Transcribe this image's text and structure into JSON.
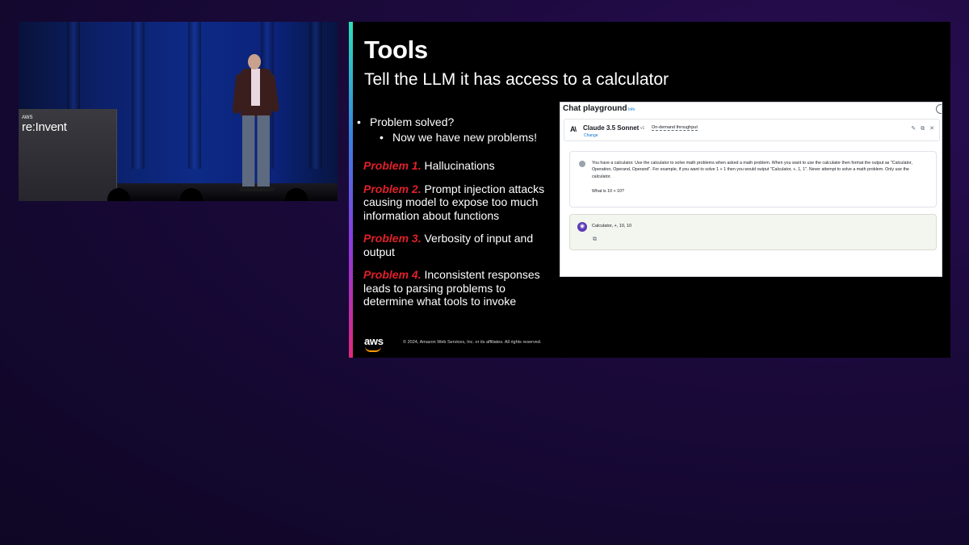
{
  "video": {
    "podium_logo_small": "AWS",
    "podium_logo": "re:Invent"
  },
  "slide": {
    "title": "Tools",
    "subtitle": "Tell the LLM it has access to a calculator",
    "bullets": [
      {
        "text": "Problem solved?",
        "sub": "Now we have new problems!"
      }
    ],
    "problems": [
      {
        "tag": "Problem 1.",
        "text": "Hallucinations"
      },
      {
        "tag": "Problem 2.",
        "text": "Prompt injection attacks causing model to expose too much information about functions"
      },
      {
        "tag": "Problem 3.",
        "text": "Verbosity of input and output"
      },
      {
        "tag": "Problem 4.",
        "text": "Inconsistent responses leads to parsing problems to determine what tools to invoke"
      }
    ],
    "footer_logo": "aws",
    "copyright": "© 2024, Amazon Web Services, Inc. or its affiliates. All rights reserved."
  },
  "playground": {
    "title": "Chat playground",
    "info": "Info",
    "model_icon": "A\\",
    "model_name": "Claude 3.5 Sonnet",
    "model_version": "v1",
    "throughput": "On-demand throughput",
    "change": "Change",
    "icons": [
      "broom-icon",
      "copy-icon",
      "close-icon"
    ],
    "user_prompt": "You have a calculator. Use the calculator to solve math problems when asked a math problem. When you want to use the calculator then format the output as \"Calculator, Operation, Operand, Operand\". For example, if you want to solve 1 + 1 then you would output \"Calculator, +, 1, 1\". Never attempt to solve a math problem. Only use the calculator.",
    "user_question": "What is 10 + 10?",
    "assistant_response": "Calculator, +, 10, 10"
  },
  "colors": {
    "accent_problem": "#e0202a",
    "background": "#1c0a3d",
    "link": "#0972d3"
  }
}
